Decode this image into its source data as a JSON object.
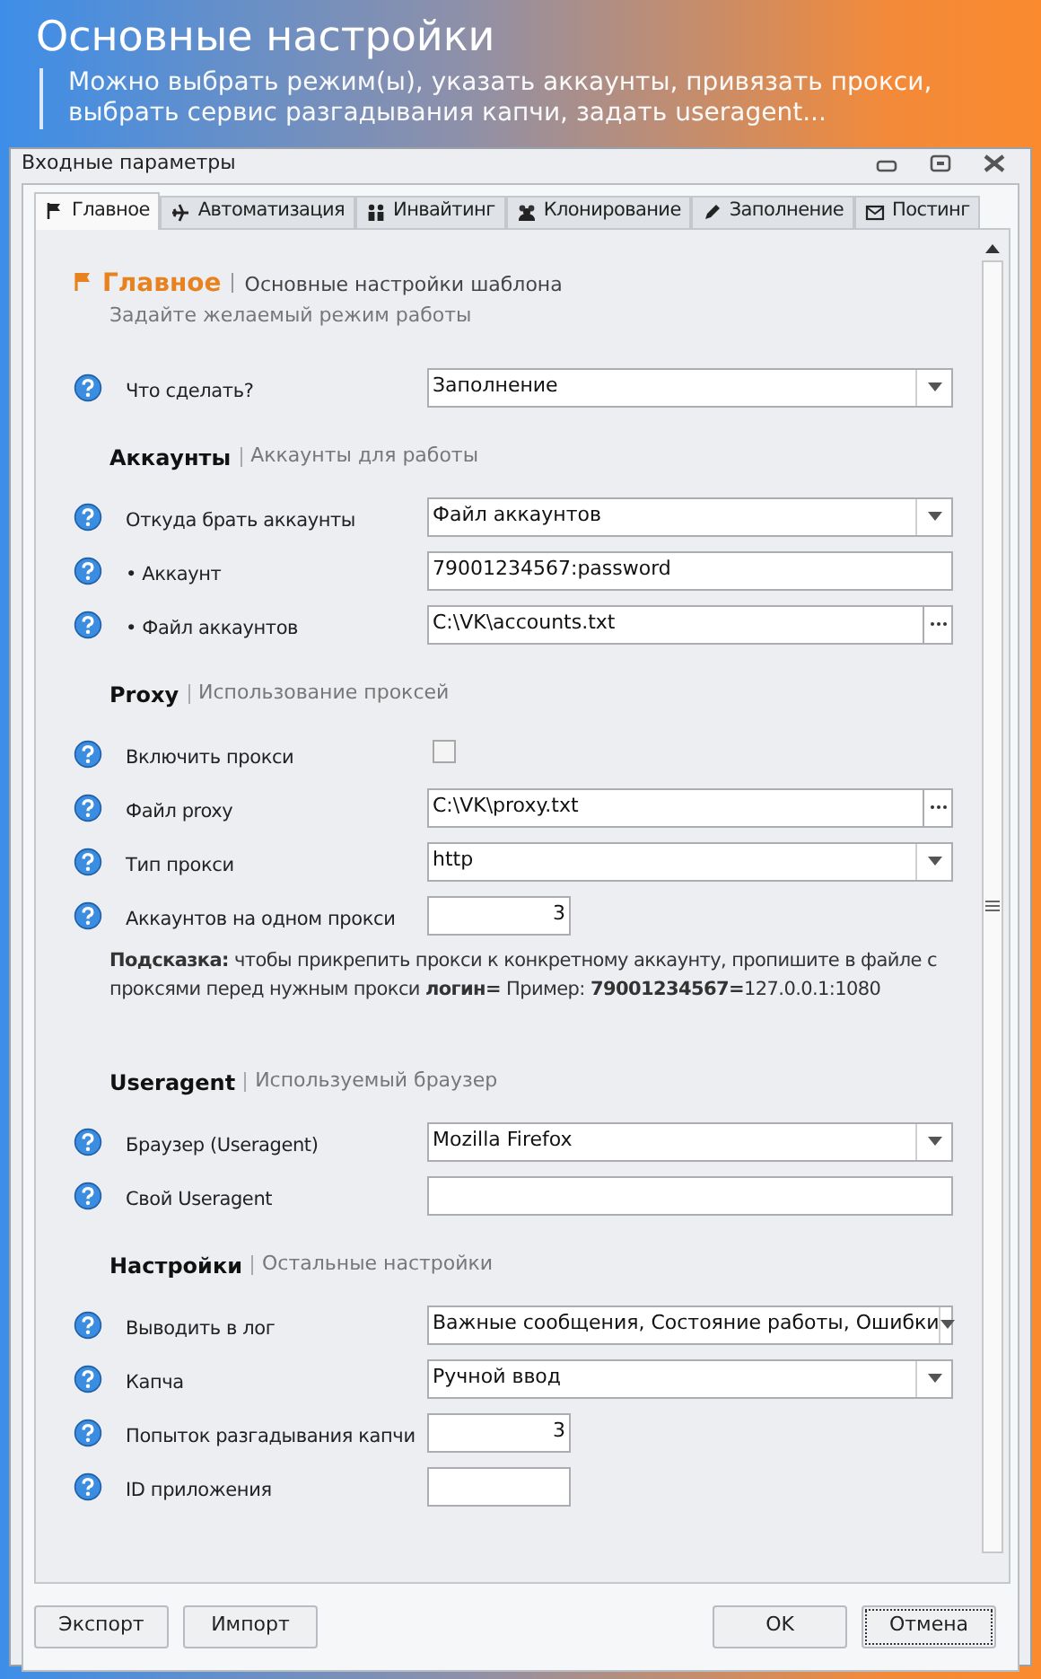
{
  "banner": {
    "title": "Основные настройки",
    "lines": [
      "Можно выбрать режим(ы), указать аккаунты, привязать прокси,",
      "выбрать сервис разгадывания капчи, задать useragent..."
    ]
  },
  "window": {
    "title": "Входные параметры"
  },
  "tabs": [
    {
      "label": "Главное",
      "selected": true
    },
    {
      "label": "Автоматизация",
      "selected": false
    },
    {
      "label": "Инвайтинг",
      "selected": false
    },
    {
      "label": "Клонирование",
      "selected": false
    },
    {
      "label": "Заполнение",
      "selected": false
    },
    {
      "label": "Постинг",
      "selected": false
    }
  ],
  "page": {
    "title": "Главное",
    "subtitle": "Основные настройки шаблона",
    "description": "Задайте желаемый режим работы"
  },
  "sections": [
    {
      "rows": [
        {
          "kind": "combo",
          "label": "Что сделать?",
          "value": "Заполнение"
        }
      ]
    },
    {
      "title": "Аккаунты",
      "subtitle": "Аккаунты для работы",
      "rows": [
        {
          "kind": "combo",
          "label": "Откуда брать аккаунты",
          "value": "Файл аккаунтов"
        },
        {
          "kind": "text",
          "label": "• Аккаунт",
          "value": "79001234567:password"
        },
        {
          "kind": "file",
          "label": "• Файл аккаунтов",
          "value": "C:\\VK\\accounts.txt"
        }
      ]
    },
    {
      "title": "Proxy",
      "subtitle": "Использование проксей",
      "rows": [
        {
          "kind": "checkbox",
          "label": "Включить прокси",
          "checked": false
        },
        {
          "kind": "file",
          "label": "Файл proxy",
          "value": "C:\\VK\\proxy.txt"
        },
        {
          "kind": "combo",
          "label": "Тип прокси",
          "value": "http"
        },
        {
          "kind": "number",
          "label": "Аккаунтов на одном прокси",
          "value": "3"
        }
      ],
      "hint": "**Подсказка:** чтобы прикрепить прокси к конкретному аккаунту, пропишите в файле с проксями перед нужным прокси **логин=**  Пример: **79001234567=**127.0.0.1:1080"
    },
    {
      "title": "Useragent",
      "subtitle": "Используемый браузер",
      "rows": [
        {
          "kind": "combo",
          "label": "Браузер (Useragent)",
          "value": "Mozilla Firefox"
        },
        {
          "kind": "text",
          "label": "Свой Useragent"
        }
      ]
    },
    {
      "title": "Настройки",
      "subtitle": "Остальные настройки",
      "rows": [
        {
          "kind": "combo",
          "label": "Выводить в лог",
          "value": "Важные сообщения, Состояние работы, Ошибки"
        },
        {
          "kind": "combo",
          "label": "Капча",
          "value": "Ручной ввод"
        },
        {
          "kind": "number",
          "label": "Попыток разгадывания капчи",
          "value": "3"
        },
        {
          "kind": "number",
          "label": "ID приложения"
        }
      ]
    }
  ],
  "buttons_left": [
    "Экспорт",
    "Импорт"
  ],
  "buttons_right": [
    {
      "label": "OK",
      "focused": false
    },
    {
      "label": "Отмена",
      "focused": true
    }
  ]
}
